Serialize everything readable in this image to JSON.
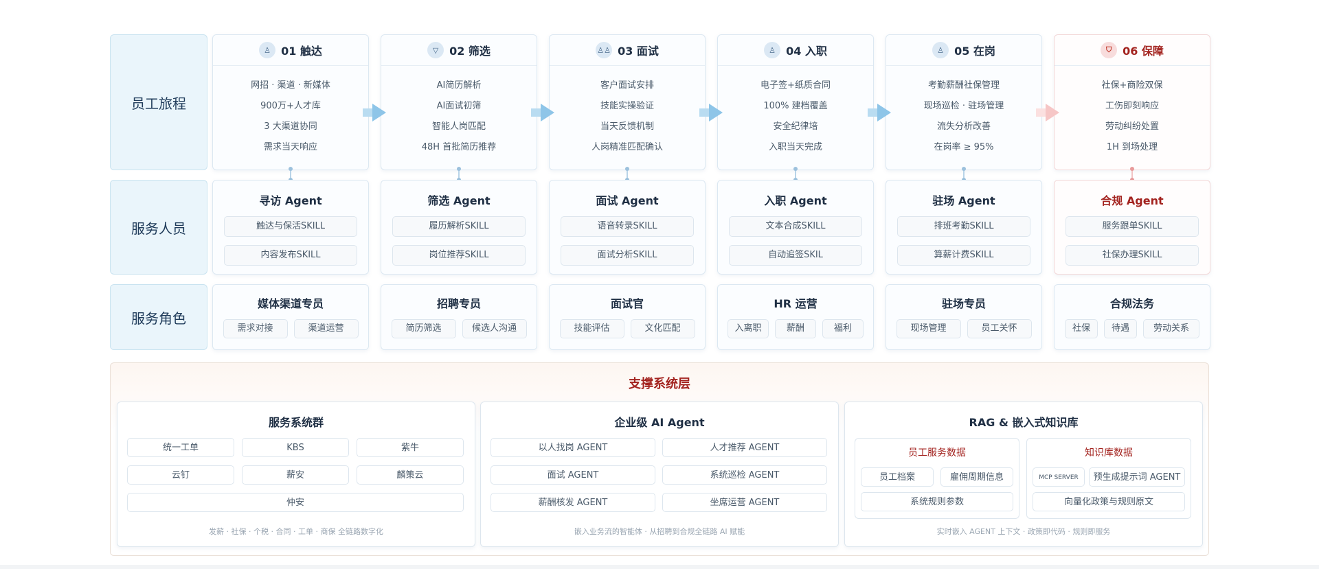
{
  "row_labels": {
    "journey": "员工旅程",
    "staff": "服务人员",
    "roles": "服务角色"
  },
  "stages": [
    {
      "title": "01 触达",
      "icon": "user-search-icon",
      "lines": [
        "网招 · 渠道 · 新媒体",
        "900万+人才库",
        "3 大渠道协同",
        "需求当天响应"
      ]
    },
    {
      "title": "02 筛选",
      "icon": "filter-icon",
      "lines": [
        "AI简历解析",
        "AI面试初筛",
        "智能人岗匹配",
        "48H 首批简历推荐"
      ]
    },
    {
      "title": "03 面试",
      "icon": "users-icon",
      "lines": [
        "客户面试安排",
        "技能实操验证",
        "当天反馈机制",
        "人岗精准匹配确认"
      ]
    },
    {
      "title": "04 入职",
      "icon": "user-check-icon",
      "lines": [
        "电子签+纸质合同",
        "100% 建档覆盖",
        "安全纪律培",
        "入职当天完成"
      ]
    },
    {
      "title": "05 在岗",
      "icon": "user-icon",
      "lines": [
        "考勤薪酬社保管理",
        "现场巡检 · 驻场管理",
        "流失分析改善",
        "在岗率 ≥ 95%"
      ]
    },
    {
      "title": "06 保障",
      "icon": "shield-icon",
      "lines": [
        "社保+商险双保",
        "工伤即刻响应",
        "劳动纠纷处置",
        "1H 到场处理"
      ]
    }
  ],
  "agents": [
    {
      "name": "寻访 Agent",
      "skills": [
        "触达与保活SKILL",
        "内容发布SKILL"
      ]
    },
    {
      "name": "筛选 Agent",
      "skills": [
        "履历解析SKILL",
        "岗位推荐SKILL"
      ]
    },
    {
      "name": "面试 Agent",
      "skills": [
        "语音转录SKILL",
        "面试分析SKILL"
      ]
    },
    {
      "name": "入职 Agent",
      "skills": [
        "文本合成SKILL",
        "自动追签SKIL"
      ]
    },
    {
      "name": "驻场 Agent",
      "skills": [
        "排班考勤SKILL",
        "算薪计费SKILL"
      ]
    },
    {
      "name": "合规 Agent",
      "skills": [
        "服务跟单SKILL",
        "社保办理SKILL"
      ]
    }
  ],
  "roles": [
    {
      "name": "媒体渠道专员",
      "tags": [
        "需求对接",
        "渠道运营"
      ]
    },
    {
      "name": "招聘专员",
      "tags": [
        "简历筛选",
        "候选人沟通"
      ]
    },
    {
      "name": "面试官",
      "tags": [
        "技能评估",
        "文化匹配"
      ]
    },
    {
      "name": "HR 运营",
      "tags": [
        "入离职",
        "薪酬",
        "福利"
      ]
    },
    {
      "name": "驻场专员",
      "tags": [
        "现场管理",
        "员工关怀"
      ]
    },
    {
      "name": "合规法务",
      "tags": [
        "社保",
        "待遇",
        "劳动关系"
      ]
    }
  ],
  "support": {
    "title": "支撑系统层",
    "service_systems": {
      "title": "服务系统群",
      "items": [
        "统一工单",
        "KBS",
        "紫牛",
        "云钉",
        "薪安",
        "麟策云",
        "仲安"
      ],
      "note": "发薪 · 社保 · 个税 · 合同 · 工单 · 商保 全链路数字化"
    },
    "ai_agents": {
      "title": "企业级 AI Agent",
      "items": [
        "以人找岗 AGENT",
        "人才推荐 AGENT",
        "面试 AGENT",
        "系统巡检 AGENT",
        "薪酬核发 AGENT",
        "坐席运营 AGENT"
      ],
      "note": "嵌入业务流的智能体 · 从招聘到合规全链路 AI 赋能"
    },
    "rag": {
      "title": "RAG & 嵌入式知识库",
      "employee": {
        "title": "员工服务数据",
        "items": [
          "员工档案",
          "雇佣周期信息",
          "系统规则参数"
        ]
      },
      "knowledge": {
        "title": "知识库数据",
        "items": [
          "MCP SERVER",
          "预生成提示词 AGENT",
          "向量化政策与规则原文"
        ]
      },
      "note": "实时嵌入 AGENT 上下文 · 政策即代码 · 规则即服务"
    }
  },
  "colors": {
    "accent_red": "#a3231f",
    "journey_blue": "#eaf5fb",
    "arrow_blue": "#8ec5e8"
  }
}
